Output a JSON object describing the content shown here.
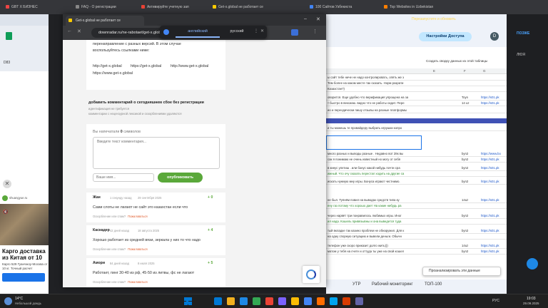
{
  "background_tabs": [
    {
      "label": "GBT Х БИЗНЕС",
      "color": "#e44"
    },
    {
      "label": "FAQ - О регистрации",
      "color": "#888"
    },
    {
      "label": "Активируйте учетную зап",
      "color": "#ea4335"
    },
    {
      "label": "Get-x.global не работает се",
      "color": "#ffcc00"
    },
    {
      "label": "100 Сайтов Узбекиста",
      "color": "#4285f4"
    },
    {
      "label": "Top Websites in Uzbekistan",
      "color": "#ff7f00"
    }
  ],
  "background_window": {
    "share_button": "Настройки Доступа",
    "restore_notice": "Перезапустите и обновить",
    "table_hint": "Создать сводку данных из этой таблицы",
    "cell_ref": "D83",
    "right_labels": [
      "ПОЗЖЕ",
      "ЛЮЯ"
    ],
    "col_headers": [
      "E",
      "F",
      "G"
    ]
  },
  "sheet_rows": [
    {
      "text": "ы сайт тебе ниче не надо контролировать, опять же з",
      "f": "",
      "g": ""
    },
    {
      "text": "Тем более на каком месте так сказать. Норм разрати",
      "f": "",
      "g": ""
    },
    {
      "text": "Казахстан?)",
      "f": "",
      "g": ""
    },
    {
      "text": "оворится. Еще удобно что верификация упрощена на за",
      "f": "Toyn",
      "g": "https://s01.pk"
    },
    {
      "text": "т быстро в вексиаю. видно что не работы сидит. Пере",
      "f": "14 uz",
      "g": "https://s01.pk"
    },
    {
      "text": "ио и переодически пишу отзывы на разные платформы",
      "f": "",
      "g": ""
    },
    {
      "text": "и ты можешь те провайдеру выбрать игрушки копро",
      "f": "",
      "g": ""
    },
    {
      "text": "много разных и выводы разные . Недавно вот 28к вы",
      "f": "byn2",
      "g": "https://www.bo"
    },
    {
      "text": "сак я понимаю не очень известный но могу от себя",
      "f": "byn2",
      "g": "https://s01.pk"
    },
    {
      "text": "в кинуc улетиш . или бонус какой нибудь почти сра",
      "f": "byn2",
      "g": "https://s01.pk"
    },
    {
      "text": "ижный. Что очу сказать перестал ходить на другие са",
      "f": "",
      "g": ""
    },
    {
      "text": "искать нужную мну игры. Бонуса играют честнимо. ",
      "f": "byn2",
      "g": "https://s01.pk"
    },
    {
      "text": "не был. Тупнём повил на выводах средств типа ку",
      "f": "14uz",
      "g": "https://s01.pk"
    },
    {
      "text": "ену газ потому что хорошо дает На какие нибудь ра",
      "f": "",
      "g": ""
    },
    {
      "text": "через нарвёт три понравилось любимых игры. Иног",
      "f": "byn2",
      "g": "https://s01.pk"
    },
    {
      "text": "ил нада. Кошель привязывны и она выведется туда",
      "f": "",
      "g": ""
    },
    {
      "text": "тый вкладке так казино проблем не обнаружил. Для к",
      "f": "byn2",
      "g": "https://s01.pk"
    },
    {
      "text": "на одну спорную ситуацию и вывели деньги. Обычн",
      "f": "",
      "g": ""
    },
    {
      "text": "телефон уже скоро приказит долго жить)))",
      "f": "14uz",
      "g": "https://s01.pk"
    },
    {
      "text": "матом у тебя на счете и оттуда ты уже на свой кошел",
      "f": "byn2",
      "g": "https://s01.pk"
    }
  ],
  "analyze_panel": "Проанализировать эти данные",
  "bottom_tabs": [
    "УТР",
    "Рабочий мониторинг",
    "ТОП-100"
  ],
  "popup": {
    "tab_title": "Get-x.global не работает се",
    "url": "downradar.ru/ne-rabotaet/get-x.global",
    "translate": {
      "from": "английский",
      "to": "русский"
    },
    "mirror_text": [
      "перенаправление с разных версий. В этом случае",
      "воспользуйтесь ссылками ниже:"
    ],
    "mirror_links": [
      "http://get-x.global",
      "https://get-x.global",
      "http://www.get-x.global",
      "https://www.get-x.global"
    ],
    "comment_heading": "добавить комментарий о сегодняшнем сбое без регистрации",
    "comment_notes": [
      "идентификация не требуется",
      "комментарии с нецензурной лексикой и оскорблениями удаляются"
    ],
    "typed_prefix": "Вы напечатали",
    "typed_count": "0",
    "typed_suffix": "символов",
    "textarea_placeholder": "Введите текст комментария...",
    "name_placeholder": "Ваше имя...",
    "publish_button": "опубликовать",
    "comments": [
      {
        "name": "Жан",
        "time": "1 секунду назад",
        "date": "29 сентября 2025",
        "rating": "0",
        "body": "Сами слоты не лагают не сайт это казахстан если что",
        "report": "Оскорбление или спам?",
        "report_link": "Пожаловаться"
      },
      {
        "name": "Каскадер",
        "time": "42 дней назад",
        "date": "18 августа 2025",
        "rating": "4",
        "body": "Хорошо работает из средней вязи, зеркала у них то что надо",
        "report": "Оскорбление или спам?",
        "report_link": "Пожаловаться"
      },
      {
        "name": "Амори",
        "time": "84 дней назад",
        "date": "8 июля 2025",
        "rating": "5",
        "body": "Работает, пинг 30-40 из рф, 45-50 из литвы, фс не лагают",
        "report": "Оскорбление или спам?",
        "report_link": "Пожаловаться"
      }
    ]
  },
  "ad": {
    "domain": "shuangyue.ru",
    "title": "Карго доставка из Китая от 10 кг. Низкие цены",
    "text": "Карго 529 Гуанчжоу-Москва от 10 кг. Точный расчет стоимости."
  },
  "taskbar": {
    "weather_temp": "14°C",
    "weather_desc": "Небольшой дождь",
    "lang": "РУС",
    "time": "19:03",
    "date": "29.09.2025",
    "app_colors": [
      "#0078d4",
      "#f2b01e",
      "#1e88e5",
      "#34a853",
      "#ea4335",
      "#7b61ff",
      "#fbbc04",
      "#4285f4",
      "#ff6d00",
      "#00a4ef",
      "#d83b01",
      "#6264a7"
    ]
  }
}
